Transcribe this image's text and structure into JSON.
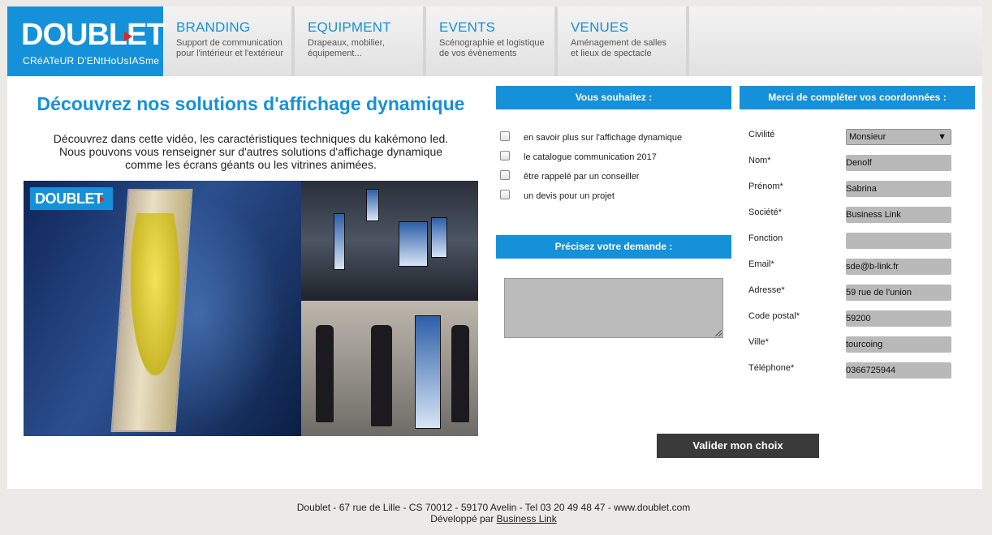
{
  "brand": {
    "name": "DOUBLET",
    "tagline": "CRéATeUR D'ENtHoUsIASme",
    "accent_color": "#1591d9",
    "logo_mark_color": "#e2261e"
  },
  "nav": [
    {
      "title": "BRANDING",
      "subtitle": "Support de communication\npour l'intérieur et l'extérieur"
    },
    {
      "title": "EQUIPMENT",
      "subtitle": "Drapeaux, mobilier,\néquipement..."
    },
    {
      "title": "EVENTS",
      "subtitle": "Scénographie et logistique\nde vos évènements"
    },
    {
      "title": "VENUES",
      "subtitle": "Aménagement de salles\net lieux de spectacle"
    }
  ],
  "hero": {
    "title": "Découvrez nos solutions d'affichage dynamique",
    "intro": "Découvrez dans cette vidéo, les caractéristiques techniques du kakémono led.\nNous pouvons vous renseigner sur d'autres solutions d'affichage dynamique\ncomme les écrans géants ou les vitrines animées.",
    "video_logo": "DOUBLET"
  },
  "wishes": {
    "header": "Vous souhaitez :",
    "options": [
      "en savoir plus sur l'affichage dynamique",
      "le catalogue communication 2017",
      "être rappelé par un conseiller",
      "un devis pour un projet"
    ]
  },
  "request": {
    "header": "Précisez votre demande :",
    "value": ""
  },
  "contact": {
    "header": "Merci de compléter vos coordonnées :",
    "fields": [
      {
        "label": "Civilité",
        "value": "Monsieur",
        "type": "select"
      },
      {
        "label": "Nom*",
        "value": "Denolf",
        "type": "text"
      },
      {
        "label": "Prénom*",
        "value": "Sabrina",
        "type": "text"
      },
      {
        "label": "Société*",
        "value": "Business Link",
        "type": "text"
      },
      {
        "label": "Fonction",
        "value": "",
        "type": "text"
      },
      {
        "label": "Email*",
        "value": "sde@b-link.fr",
        "type": "text"
      },
      {
        "label": "Adresse*",
        "value": "59 rue de l'union",
        "type": "text"
      },
      {
        "label": "Code postal*",
        "value": "59200",
        "type": "text"
      },
      {
        "label": "Ville*",
        "value": "tourcoing",
        "type": "text"
      },
      {
        "label": "Téléphone*",
        "value": "0366725944",
        "type": "text"
      }
    ],
    "select_arrow": "▼"
  },
  "submit_label": "Valider mon choix",
  "footer": {
    "address": "Doublet - 67 rue de Lille - CS 70012 - 59170 Avelin - Tel 03 20 49 48 47 - www.doublet.com",
    "dev_prefix": "Développé par",
    "dev_link": "Business Link"
  }
}
